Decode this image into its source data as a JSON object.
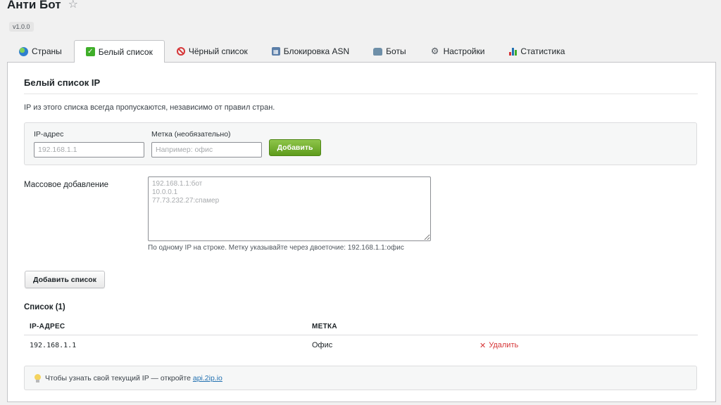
{
  "header": {
    "title": "Анти Бот",
    "version": "v1.0.0",
    "star_glyph": "☆"
  },
  "tabs": [
    {
      "label": "Страны",
      "icon": "globe-icon"
    },
    {
      "label": "Белый список",
      "icon": "checkmark-icon",
      "active": true
    },
    {
      "label": "Чёрный список",
      "icon": "ban-icon"
    },
    {
      "label": "Блокировка ASN",
      "icon": "asn-icon"
    },
    {
      "label": "Боты",
      "icon": "bot-icon"
    },
    {
      "label": "Настройки",
      "icon": "gear-icon"
    },
    {
      "label": "Статистика",
      "icon": "chart-icon"
    }
  ],
  "whitelist": {
    "title": "Белый список IP",
    "intro": "IP из этого списка всегда пропускаются, независимо от правил стран.",
    "ip_field": {
      "label": "IP-адрес",
      "placeholder": "192.168.1.1",
      "value": ""
    },
    "tag_field": {
      "label": "Метка (необязательно)",
      "placeholder": "Например: офис",
      "value": ""
    },
    "add_button": "Добавить",
    "bulk": {
      "label": "Массовое добавление",
      "placeholder": "192.168.1.1:бот\n10.0.0.1\n77.73.232.27:спамер",
      "hint": "По одному IP на строке. Метку указывайте через двоеточие: 192.168.1.1:офис",
      "button": "Добавить список"
    },
    "list": {
      "title": "Список (1)",
      "columns": [
        "IP-АДРЕС",
        "МЕТКА"
      ],
      "rows": [
        {
          "ip": "192.168.1.1",
          "tag": "Офис",
          "action": "Удалить",
          "action_glyph": "✕"
        }
      ]
    },
    "tip": {
      "text": "Чтобы узнать свой текущий IP — откройте ",
      "link": "api.2ip.io"
    }
  },
  "colors": {
    "accent_green": "#5e9c1c",
    "danger_red": "#d63638",
    "link_blue": "#2271b1"
  }
}
